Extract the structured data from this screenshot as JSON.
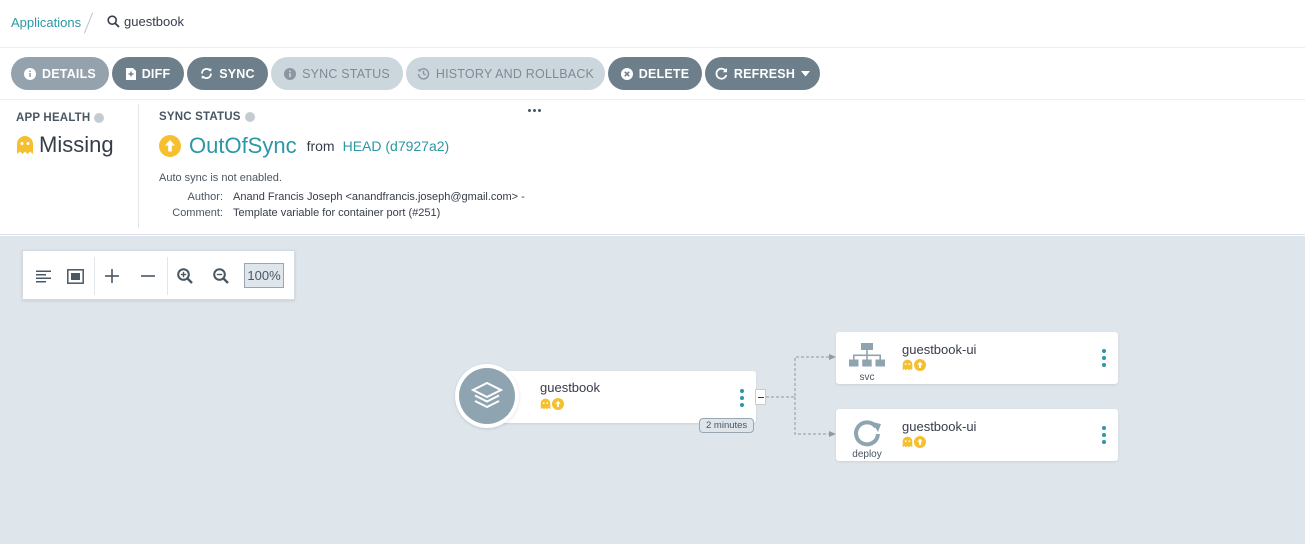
{
  "breadcrumb": {
    "root_label": "Applications",
    "current_label": "guestbook"
  },
  "toolbar": {
    "details_label": "DETAILS",
    "diff_label": "DIFF",
    "sync_label": "SYNC",
    "sync_status_label": "SYNC STATUS",
    "history_label": "HISTORY AND ROLLBACK",
    "delete_label": "DELETE",
    "refresh_label": "REFRESH"
  },
  "app_health": {
    "title": "APP HEALTH",
    "value": "Missing"
  },
  "sync_status": {
    "title": "SYNC STATUS",
    "value": "OutOfSync",
    "from_label": "from",
    "revision": "HEAD (d7927a2)",
    "auto_sync": "Auto sync is not enabled.",
    "author_key": "Author:",
    "author_value": "Anand Francis Joseph <anandfrancis.joseph@gmail.com> -",
    "comment_key": "Comment:",
    "comment_value": "Template variable for container port (#251)"
  },
  "graph": {
    "zoom_value": "100%",
    "app_node": {
      "name": "guestbook",
      "age": "2 minutes"
    },
    "resource_nodes": [
      {
        "name": "guestbook-ui",
        "kind": "svc"
      },
      {
        "name": "guestbook-ui",
        "kind": "deploy"
      }
    ]
  },
  "colors": {
    "accent": "#2b97a7",
    "missing": "#f4c030",
    "outofsync": "#f4c030",
    "button_dark": "#6d7f8b",
    "button_light": "#94a2ae",
    "canvas": "#dee5eb"
  }
}
